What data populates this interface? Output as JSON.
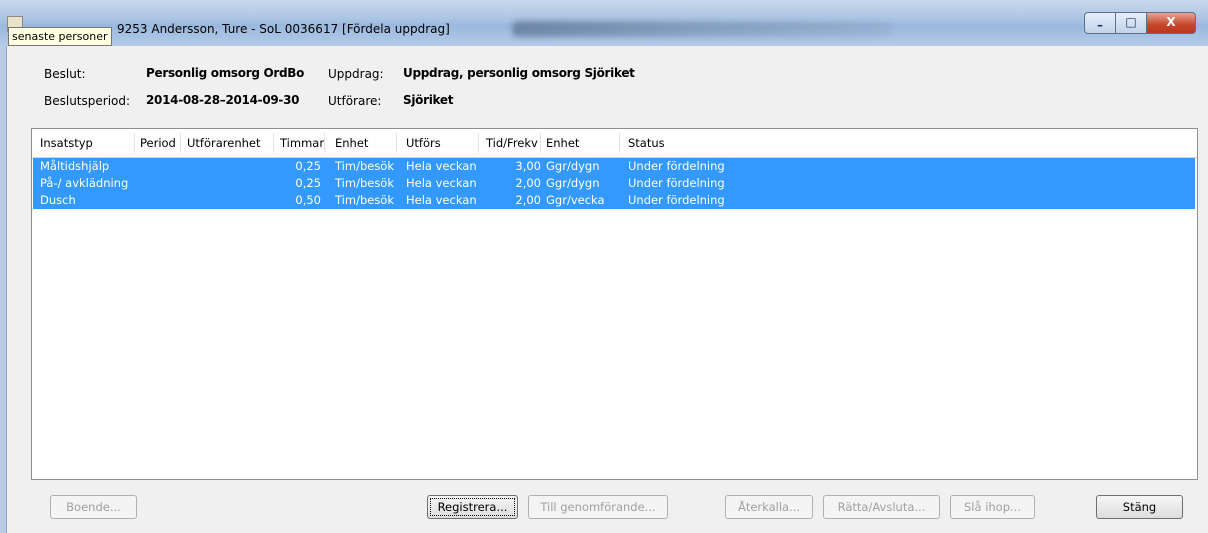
{
  "window": {
    "title_visible": "9253  Andersson, Ture  -  SoL  0036617  [Fördela uppdrag]",
    "tooltip": "senaste personer",
    "buttons": {
      "minimize": "–",
      "maximize": "□",
      "close": "X"
    }
  },
  "info": {
    "beslut_label": "Beslut:",
    "beslut_value": "Personlig omsorg OrdBo",
    "beslutsperiod_label": "Beslutsperiod:",
    "beslutsperiod_value": "2014-08-28–2014-09-30",
    "uppdrag_label": "Uppdrag:",
    "uppdrag_value": "Uppdrag, personlig omsorg Sjöriket",
    "utforare_label": "Utförare:",
    "utforare_value": "Sjöriket"
  },
  "table": {
    "columns": [
      "Insatstyp",
      "Period",
      "Utförarenhet",
      "Timmar",
      "Enhet",
      "Utförs",
      "Tid/Frekv",
      "Enhet",
      "Status"
    ],
    "rows": [
      {
        "insatstyp": "Måltidshjälp",
        "period": "",
        "utforarenhet": "",
        "timmar": "0,25",
        "enhet": "Tim/besök",
        "utfors": "Hela veckan",
        "tidfrekv": "3,00",
        "enhet2": "Ggr/dygn",
        "status": "Under fördelning"
      },
      {
        "insatstyp": "På-/ avklädning",
        "period": "",
        "utforarenhet": "",
        "timmar": "0,25",
        "enhet": "Tim/besök",
        "utfors": "Hela veckan",
        "tidfrekv": "2,00",
        "enhet2": "Ggr/dygn",
        "status": "Under fördelning"
      },
      {
        "insatstyp": "Dusch",
        "period": "",
        "utforarenhet": "",
        "timmar": "0,50",
        "enhet": "Tim/besök",
        "utfors": "Hela veckan",
        "tidfrekv": "2,00",
        "enhet2": "Ggr/vecka",
        "status": "Under fördelning"
      }
    ]
  },
  "buttons": {
    "boende": "Boende...",
    "registrera": "Registrera...",
    "till_genomforande": "Till genomförande...",
    "aterkalla": "Återkalla...",
    "ratta_avsluta": "Rätta/Avsluta...",
    "sla_ihop": "Slå ihop...",
    "stang": "Stäng"
  },
  "colors": {
    "selection": "#3399ff",
    "titlebar": "#a9c2e2"
  }
}
